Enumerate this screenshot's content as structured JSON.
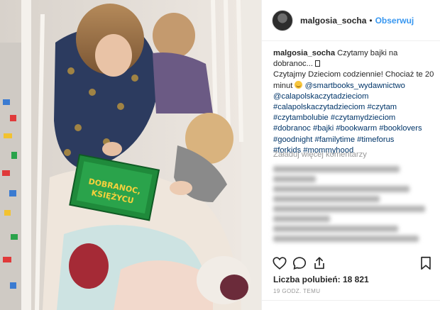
{
  "photo": {
    "book_title_line1": "DOBRANOC,",
    "book_title_line2": "KSIĘŻYCU"
  },
  "header": {
    "username": "malgosia_socha",
    "dot": "•",
    "follow_label": "Obserwuj"
  },
  "caption": {
    "username": "malgosia_socha",
    "line1": "Czytamy bajki na dobranoc...",
    "line2_start": "Czytajmy Dzieciom codziennie! Chociaż te 20 minut",
    "mention": "@smartbooks_wydawnictwo",
    "tags": [
      "@calapolskaczytadzieciom",
      "#calapolskaczytadzieciom",
      "#czytam",
      "#czytambolubie",
      "#czytamydzieciom",
      "#dobranoc",
      "#bajki",
      "#bookwarm",
      "#booklovers",
      "#goodnight",
      "#familytime",
      "#timeforus",
      "#forkids",
      "#mommyhood"
    ]
  },
  "load_more_label": "Załaduj więcej komentarzy",
  "likes_text": "Liczba polubień: 18 821",
  "timestamp": "19 GODZ. TEMU",
  "colors": {
    "link_blue": "#3897f0",
    "hashtag": "#003569",
    "muted": "#999999"
  },
  "icons": [
    "heart-icon",
    "comment-icon",
    "share-icon",
    "bookmark-icon"
  ]
}
